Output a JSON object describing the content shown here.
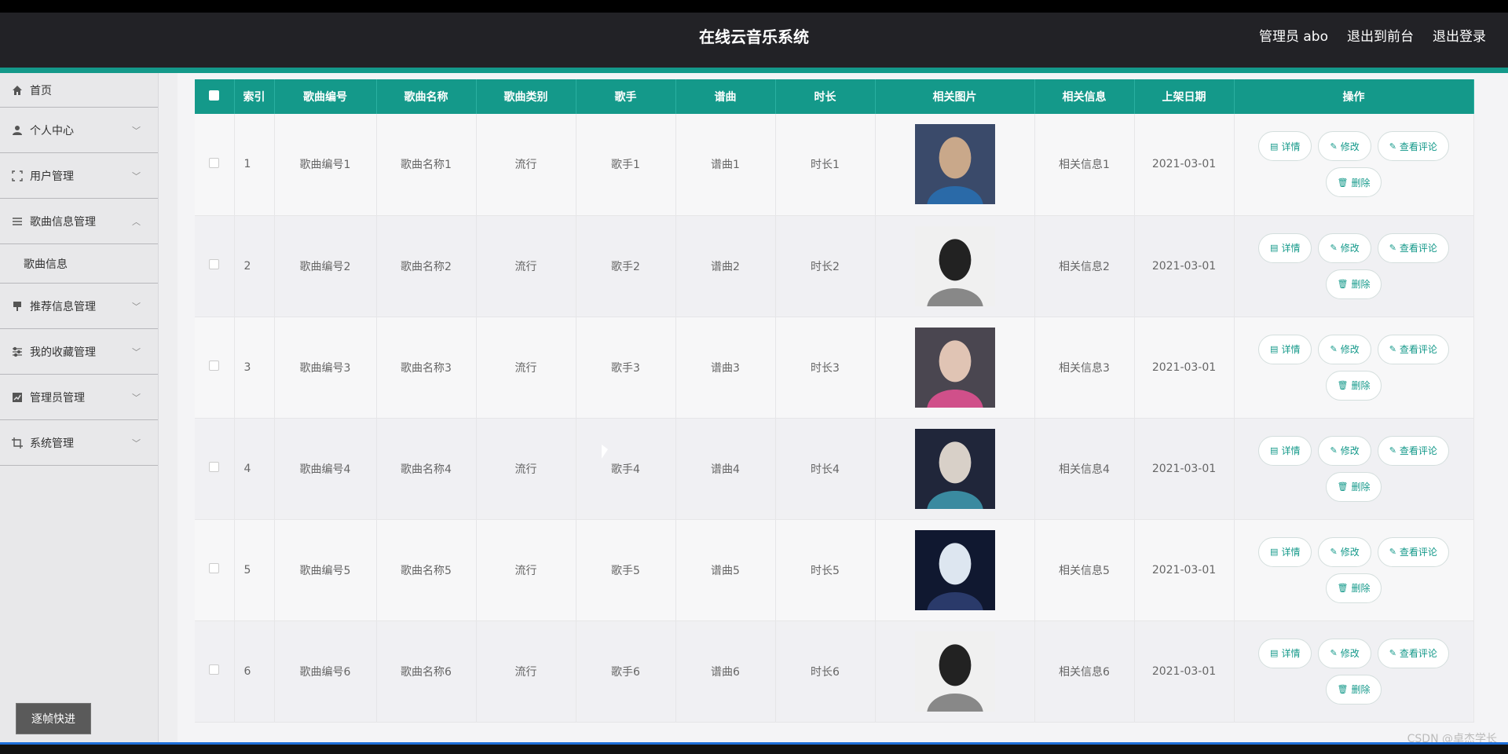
{
  "header": {
    "title": "在线云音乐系统",
    "user": "管理员 abo",
    "to_front": "退出到前台",
    "logout": "退出登录"
  },
  "sidebar": {
    "items": [
      {
        "label": "首页",
        "icon": "home-icon"
      },
      {
        "label": "个人中心",
        "icon": "user-icon"
      },
      {
        "label": "用户管理",
        "icon": "expand-icon"
      },
      {
        "label": "歌曲信息管理",
        "icon": "list-icon"
      },
      {
        "label": "推荐信息管理",
        "icon": "thumb-icon"
      },
      {
        "label": "我的收藏管理",
        "icon": "sliders-icon"
      },
      {
        "label": "管理员管理",
        "icon": "chart-icon"
      },
      {
        "label": "系统管理",
        "icon": "crop-icon"
      }
    ],
    "submenu": "歌曲信息",
    "frame_button": "逐帧快进"
  },
  "table": {
    "headers": [
      "索引",
      "歌曲编号",
      "歌曲名称",
      "歌曲类别",
      "歌手",
      "谱曲",
      "时长",
      "相关图片",
      "相关信息",
      "上架日期",
      "操作"
    ],
    "rows": [
      {
        "idx": "1",
        "code": "歌曲编号1",
        "name": "歌曲名称1",
        "type": "流行",
        "singer": "歌手1",
        "composer": "谱曲1",
        "duration": "时长1",
        "info": "相关信息1",
        "date": "2021-03-01"
      },
      {
        "idx": "2",
        "code": "歌曲编号2",
        "name": "歌曲名称2",
        "type": "流行",
        "singer": "歌手2",
        "composer": "谱曲2",
        "duration": "时长2",
        "info": "相关信息2",
        "date": "2021-03-01"
      },
      {
        "idx": "3",
        "code": "歌曲编号3",
        "name": "歌曲名称3",
        "type": "流行",
        "singer": "歌手3",
        "composer": "谱曲3",
        "duration": "时长3",
        "info": "相关信息3",
        "date": "2021-03-01"
      },
      {
        "idx": "4",
        "code": "歌曲编号4",
        "name": "歌曲名称4",
        "type": "流行",
        "singer": "歌手4",
        "composer": "谱曲4",
        "duration": "时长4",
        "info": "相关信息4",
        "date": "2021-03-01"
      },
      {
        "idx": "5",
        "code": "歌曲编号5",
        "name": "歌曲名称5",
        "type": "流行",
        "singer": "歌手5",
        "composer": "谱曲5",
        "duration": "时长5",
        "info": "相关信息5",
        "date": "2021-03-01"
      },
      {
        "idx": "6",
        "code": "歌曲编号6",
        "name": "歌曲名称6",
        "type": "流行",
        "singer": "歌手6",
        "composer": "谱曲6",
        "duration": "时长6",
        "info": "相关信息6",
        "date": "2021-03-01"
      }
    ],
    "ops": {
      "detail": "详情",
      "edit": "修改",
      "comments": "查看评论",
      "delete": "删除"
    }
  },
  "watermark": "CSDN @卓杰学长",
  "colors": {
    "accent": "#14998a",
    "header_bg": "#222226"
  }
}
